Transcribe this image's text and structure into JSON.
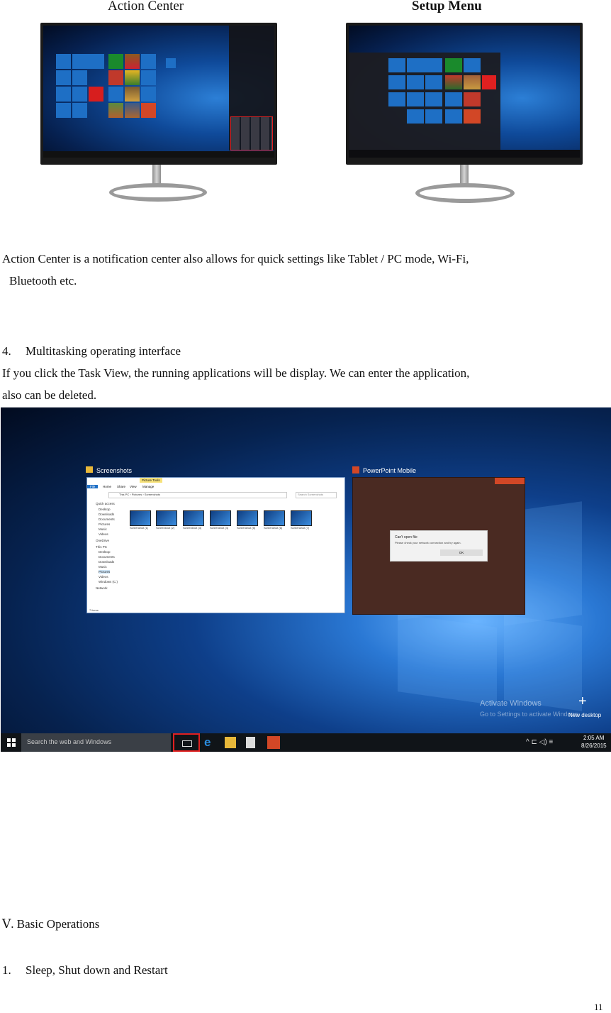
{
  "top_captions": {
    "left": "Action Center",
    "right": "Setup Menu"
  },
  "paragraph_1": "Action Center is a notification center also allows for quick settings like Tablet / PC mode, Wi-Fi,",
  "paragraph_1_cont": "Bluetooth etc.",
  "section_4_number": "4.",
  "section_4_title": "Multitasking operating interface",
  "paragraph_2_line1": "If you click the Task View, the running applications will be display. We can enter the application,",
  "paragraph_2_line2": "also can be deleted.",
  "task_view": {
    "explorer_title": "Screenshots",
    "explorer_tab_label": "Picture Tools",
    "explorer_path_label": "This PC › Pictures › Screenshots",
    "explorer_search": "Search Screenshots",
    "explorer_ribbon_tabs": [
      "File",
      "Home",
      "Share",
      "View",
      "Manage"
    ],
    "explorer_nav": [
      "Quick access",
      "Desktop",
      "Downloads",
      "Documents",
      "Pictures",
      "Music",
      "Videos",
      "OneDrive",
      "This PC",
      "Desktop",
      "Documents",
      "Downloads",
      "Music",
      "Pictures",
      "Videos",
      "Windows (C:)",
      "Network"
    ],
    "explorer_thumbs": [
      "Screenshot (1)",
      "Screenshot (2)",
      "Screenshot (3)",
      "Screenshot (4)",
      "Screenshot (5)",
      "Screenshot (6)",
      "Screenshot (7)"
    ],
    "explorer_status": "7 items",
    "ppt_title": "PowerPoint Mobile",
    "dialog_title": "Can't open file",
    "dialog_body": "Please check your network connection and try again.",
    "dialog_ok": "OK",
    "watermark_title": "Activate Windows",
    "watermark_sub": "Go to Settings to activate Windows.",
    "new_desktop_icon": "+",
    "new_desktop_label": "New desktop",
    "search_placeholder": "Search the web and Windows",
    "clock_time": "2:05 AM",
    "clock_date": "8/26/2015",
    "tray_glyphs": "^ ⊏ ◁) ≡"
  },
  "section_V": "Ⅴ. Basic Operations",
  "section_1_number": "1.",
  "section_1_title": "Sleep, Shut down and Restart",
  "page_number": "11",
  "colors": {
    "highlight_red": "#e02020",
    "ppt_orange": "#d24726",
    "ppt_bg": "#4a2a22"
  }
}
